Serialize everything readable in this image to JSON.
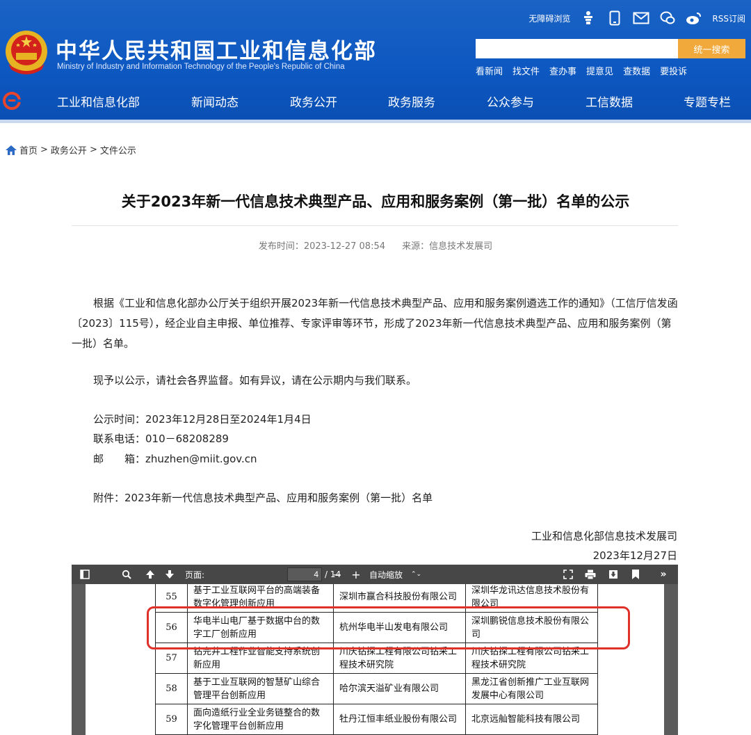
{
  "header": {
    "title_cn": "中华人民共和国工业和信息化部",
    "title_en": "Ministry of Industry and Information Technology of the People's Republic of China",
    "accessibility": "无障碍浏览",
    "rss": "RSS订阅",
    "search_placeholder": "",
    "search_button": "统一搜索",
    "quick_links": [
      "看新闻",
      "找文件",
      "查办事",
      "提意见",
      "查数据",
      "要投诉"
    ],
    "nav": [
      "工业和信息化部",
      "新闻动态",
      "政务公开",
      "政务服务",
      "公众参与",
      "工信数据",
      "专题专栏"
    ]
  },
  "breadcrumb": [
    "首页",
    "政务公开",
    "文件公示"
  ],
  "breadcrumb_sep": ">",
  "article": {
    "title": "关于2023年新一代信息技术典型产品、应用和服务案例（第一批）名单的公示",
    "publish_time": "发布时间：2023-12-27 08:54",
    "source": "来源：信息技术发展司",
    "para1": "根据《工业和信息化部办公厅关于组织开展2023年新一代信息技术典型产品、应用和服务案例遴选工作的通知》（工信厅信发函〔2023〕115号），经企业自主申报、单位推荐、专家评审等环节，形成了2023年新一代信息技术典型产品、应用和服务案例（第一批）名单。",
    "para2": "现予以公示，请社会各界监督。如有异议，请在公示期内与我们联系。",
    "period": "公示时间：2023年12月28日至2024年1月4日",
    "phone": "联系电话：010－68208289",
    "email": "邮　　箱：zhuzhen@miit.gov.cn",
    "attachment": "附件：2023年新一代信息技术典型产品、应用和服务案例（第一批）名单",
    "signature_org": "工业和信息化部信息技术发展司",
    "signature_date": "2023年12月27日"
  },
  "pdf_viewer": {
    "page_label": "页面:",
    "current_page": "4",
    "total_pages": "/ 14",
    "zoom": "自动缩放",
    "rows": [
      {
        "num": "55",
        "name": "基于工业互联网平台的高端装备数字化管理创新应用",
        "org": "深圳市赢合科技股份有限公司",
        "supplier": "深圳华龙讯达信息技术股份有限公司"
      },
      {
        "num": "56",
        "name": "华电半山电厂基于数据中台的数字工厂创新应用",
        "org": "杭州华电半山发电有限公司",
        "supplier": "深圳鹏锐信息技术股份有限公司"
      },
      {
        "num": "57",
        "name": "钻完井工程作业智能支持系统创新应用",
        "org": "川庆钻探工程有限公司钻采工程技术研究院",
        "supplier": "川庆钻探工程有限公司钻采工程技术研究院"
      },
      {
        "num": "58",
        "name": "基于工业互联网的智慧矿山综合管理平台创新应用",
        "org": "哈尔滨天溢矿业有限公司",
        "supplier": "黑龙江省创新推广工业互联网发展中心有限公司"
      },
      {
        "num": "59",
        "name": "面向造纸行业全业务链整合的数字化管理平台创新应用",
        "org": "牡丹江恒丰纸业股份有限公司",
        "supplier": "北京远舢智能科技有限公司"
      }
    ]
  },
  "colors": {
    "header_blue": "#0d58c2",
    "search_orange": "#f2a93b",
    "highlight_red": "#e0302a",
    "toolbar_gray": "#474747"
  }
}
